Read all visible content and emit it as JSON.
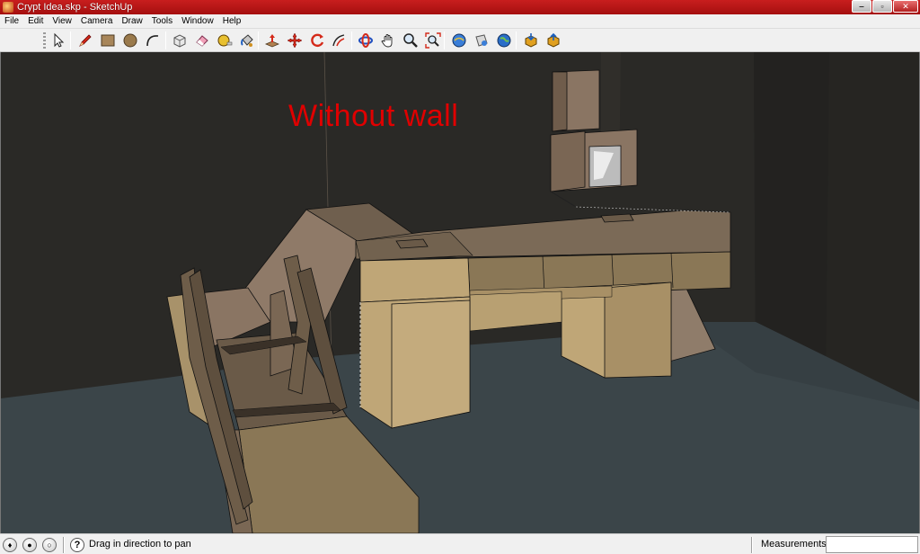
{
  "window": {
    "title": "Crypt Idea.skp - SketchUp",
    "minimize_glyph": "‒",
    "maximize_glyph": "▫",
    "close_glyph": "✕"
  },
  "menu": [
    "File",
    "Edit",
    "View",
    "Camera",
    "Draw",
    "Tools",
    "Window",
    "Help"
  ],
  "toolbar": {
    "groups": [
      [
        "select-icon"
      ],
      [
        "pencil-line-icon",
        "rectangle-icon",
        "circle-icon",
        "arc-icon"
      ],
      [
        "make-component-icon",
        "eraser-icon",
        "tape-measure-icon",
        "paint-bucket-icon"
      ],
      [
        "push-pull-icon",
        "move-icon",
        "rotate-icon",
        "offset-icon"
      ],
      [
        "orbit-icon",
        "pan-icon",
        "zoom-icon",
        "zoom-extents-icon"
      ],
      [
        "get-models-icon",
        "share-model-icon",
        "google-earth-icon"
      ],
      [
        "get-component-icon",
        "share-component-icon"
      ]
    ]
  },
  "viewport": {
    "annotation": "Without wall"
  },
  "status": {
    "hint": "Drag in direction to pan",
    "help_glyph": "?",
    "measurements_label": "Measurements",
    "measurements_value": ""
  },
  "colors": {
    "titlebar": "#b81616",
    "annotation": "#e00000",
    "floor": "#3b4549",
    "wall": "#2a2926",
    "stone_face": "#bfa677",
    "stone_side": "#8a7756",
    "stone_top": "#7b6a57"
  }
}
